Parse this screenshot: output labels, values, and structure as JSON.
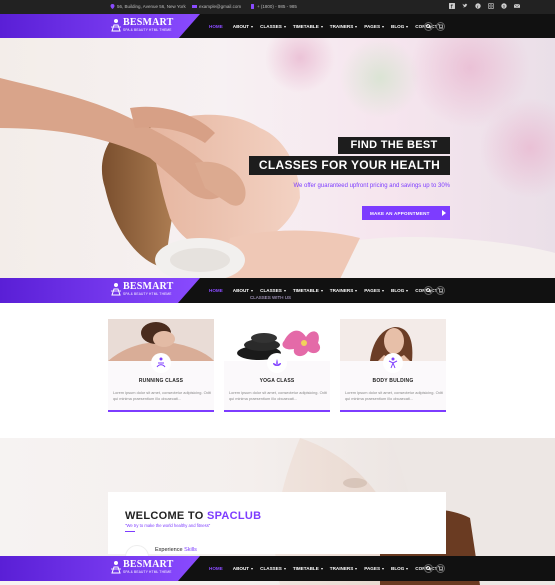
{
  "topbar": {
    "address": "56, Building, Avenue 56, New York",
    "email": "example@gmail.com",
    "phone": "+ (1800) - 985 - 985",
    "socials": [
      "facebook-icon",
      "twitter-icon",
      "pinterest-icon",
      "instagram-icon",
      "skype-icon",
      "email-icon"
    ]
  },
  "brand": {
    "title": "BESMART",
    "subtitle": "SPA & BEAUTY HTML THEME"
  },
  "nav": {
    "items": [
      {
        "label": "HOME",
        "active": true,
        "dropdown": false
      },
      {
        "label": "ABOUT",
        "active": false,
        "dropdown": true
      },
      {
        "label": "CLASSES",
        "active": false,
        "dropdown": true
      },
      {
        "label": "TIMETABLE",
        "active": false,
        "dropdown": true
      },
      {
        "label": "TRAINERS",
        "active": false,
        "dropdown": true
      },
      {
        "label": "PAGES",
        "active": false,
        "dropdown": true
      },
      {
        "label": "BLOG",
        "active": false,
        "dropdown": true
      },
      {
        "label": "CONTACT",
        "active": false,
        "dropdown": false
      }
    ]
  },
  "hero": {
    "title_line1": "FIND THE BEST",
    "title_line2": "CLASSES FOR YOUR HEALTH",
    "subtitle": "We offer guaranteed upfront pricing and savings up to 30%",
    "button": "MAKE AN APPOINTMENT"
  },
  "faded_heading": "CLASSES WITH US",
  "cards": [
    {
      "title": "RUNNING CLASS",
      "text": "Lorem ipsum dolor sit amet, consectetur adipisicing. Odit qui minima praesentium illo obcaecati...",
      "icon": "massage-icon"
    },
    {
      "title": "YOGA CLASS",
      "text": "Lorem ipsum dolor sit amet, consectetur adipisicing. Odit qui minima praesentium illo obcaecati...",
      "icon": "lotus-icon"
    },
    {
      "title": "BODY BULDING",
      "text": "Lorem ipsum dolor sit amet, consectetur adipisicing. Odit qui minima praesentium illo obcaecati...",
      "icon": "fitness-icon"
    }
  ],
  "welcome": {
    "title": "WELCOME TO",
    "accent": "SPACLUB",
    "subtitle": "\"We try to make the world healthy and fitness\"",
    "experience": "Experience",
    "experience_accent": "Skills"
  },
  "colors": {
    "accent": "#7d3cff",
    "dark": "#111111"
  }
}
